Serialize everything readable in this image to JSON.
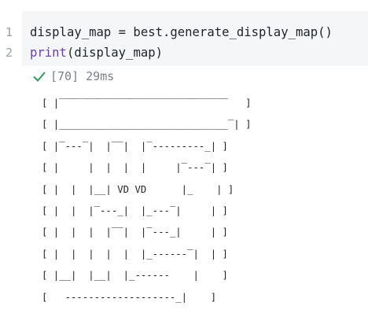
{
  "cell": {
    "line_numbers": [
      "1",
      "2"
    ],
    "code": [
      {
        "before": "display_map = best.generate_display_map()",
        "fn": "",
        "after": ""
      },
      {
        "before": "",
        "fn": "print",
        "after": "(display_map)"
      }
    ],
    "status": {
      "icon": "checkmark-icon",
      "execution_count": "[70]",
      "duration": "29ms",
      "color": "#2e9d5c"
    }
  },
  "output": {
    "lines": [
      "[ |‾‾‾‾‾‾‾‾‾‾‾‾‾‾‾‾‾‾‾‾‾‾‾‾‾‾‾‾‾   ]",
      "[ |_____________________________‾| ]",
      "[ |‾---‾|  |‾‾|  |‾---------_| ]",
      "[ |     |  |  |  |     |‾---‾| ]",
      "[ |  |  |__| VD VD      |_    | ]",
      "[ |  |  |‾---_|  |_---‾|     | ]",
      "[ |  |  |  |‾‾|  |‾---_|     | ]",
      "[ |  |  |  |  |  |_------‾|  | ]",
      "[ |__|  |__|  |_------    |    ]",
      "[   -------------------_|    ]"
    ]
  }
}
